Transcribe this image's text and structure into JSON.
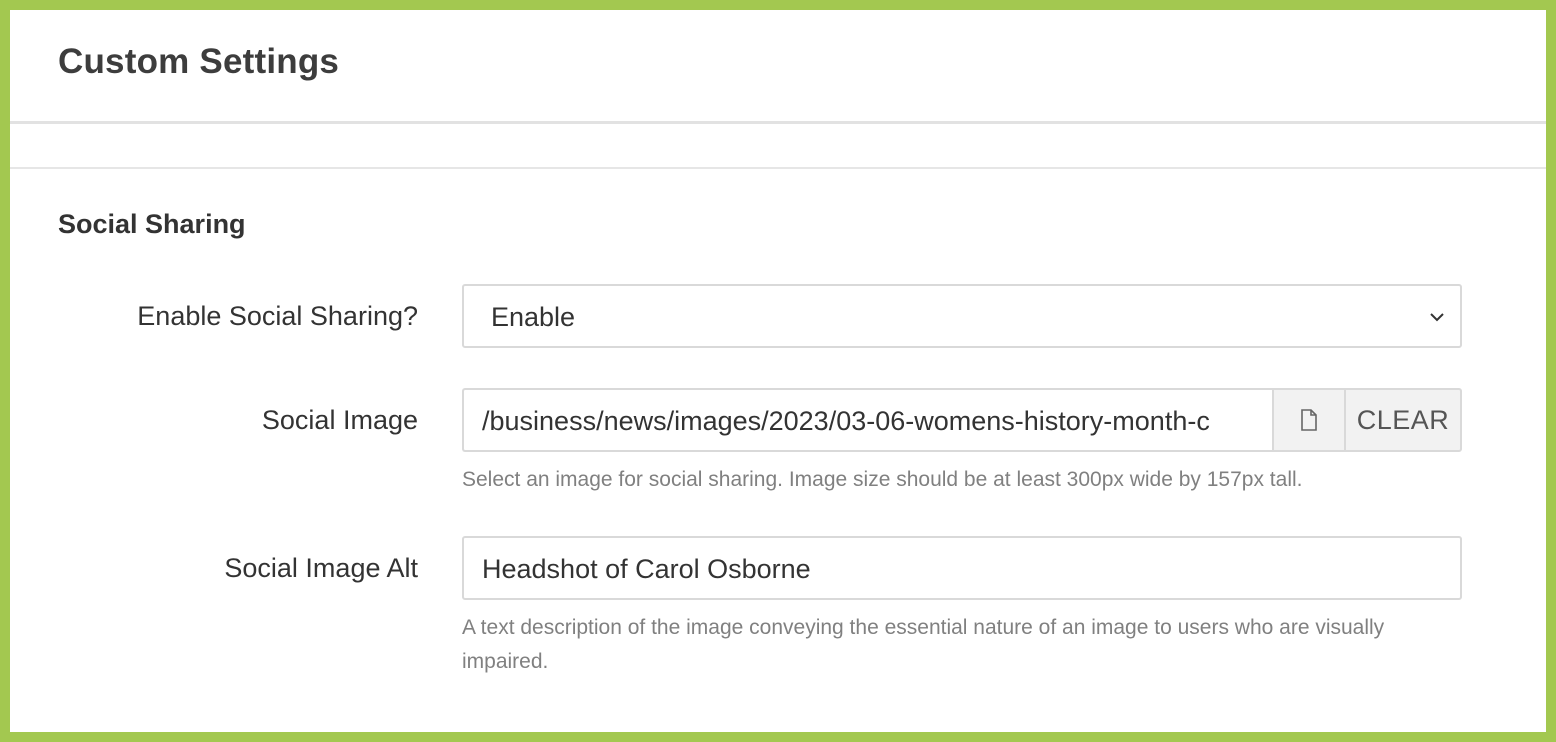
{
  "panel": {
    "title": "Custom Settings"
  },
  "social_sharing": {
    "section_title": "Social Sharing",
    "enable": {
      "label": "Enable Social Sharing?",
      "selected": "Enable"
    },
    "social_image": {
      "label": "Social Image",
      "value": "/business/news/images/2023/03-06-womens-history-month-c",
      "file_icon": "file-icon",
      "clear_label": "CLEAR",
      "help": "Select an image for social sharing. Image size should be at least 300px wide by 157px tall."
    },
    "social_image_alt": {
      "label": "Social Image Alt",
      "value": "Headshot of Carol Osborne",
      "help": "A text description of the image conveying the essential nature of an image to users who are visually impaired."
    }
  },
  "colors": {
    "frame_border": "#a3c850",
    "text": "#333333",
    "help_text": "#808080",
    "input_border": "#d9d9d9"
  }
}
